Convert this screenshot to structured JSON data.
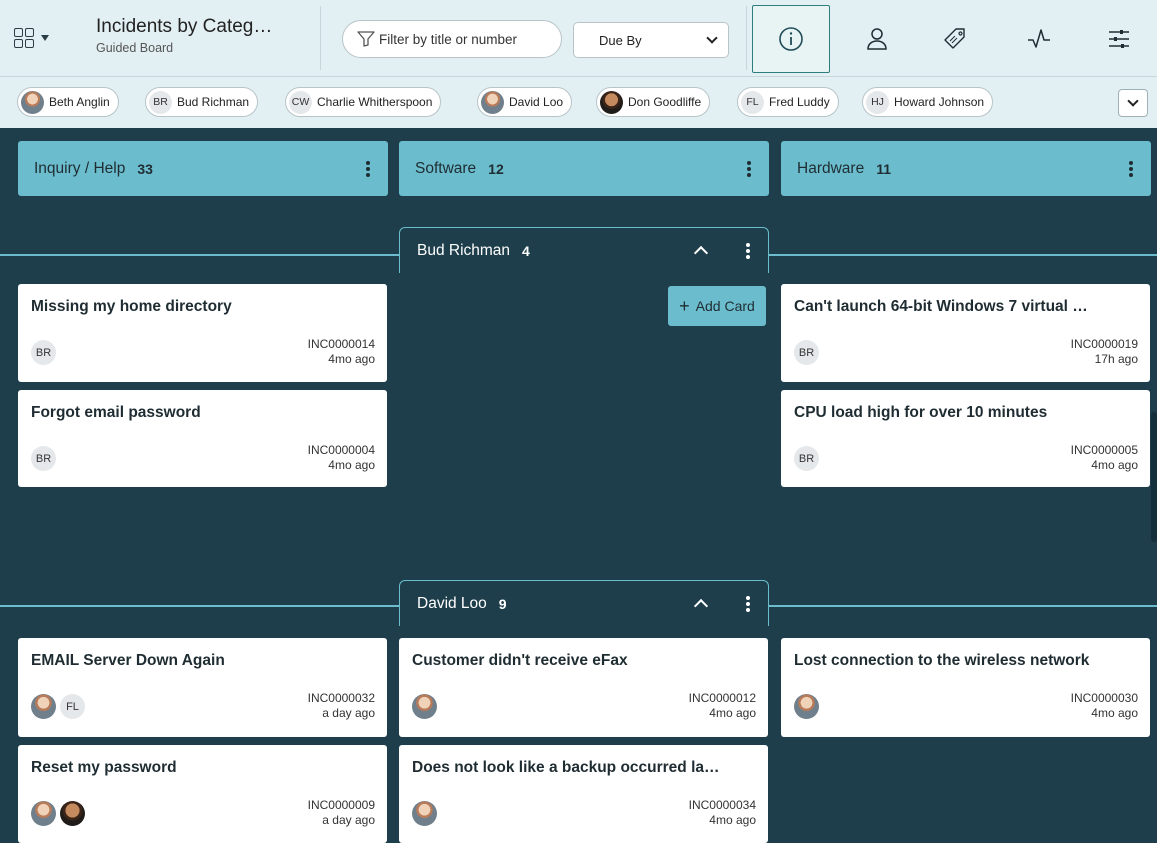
{
  "header": {
    "title": "Incidents by Categ…",
    "subtitle": "Guided Board",
    "filter_placeholder": "Filter by title or number",
    "sort_value": "Due By",
    "tools": [
      "info-icon",
      "person-icon",
      "tag-icon",
      "activity-icon",
      "sliders-icon"
    ]
  },
  "people": [
    {
      "name": "Beth Anglin",
      "initials": "",
      "photo": true
    },
    {
      "name": "Bud Richman",
      "initials": "BR",
      "photo": false
    },
    {
      "name": "Charlie Whitherspoon",
      "initials": "CW",
      "photo": false
    },
    {
      "name": "David Loo",
      "initials": "",
      "photo": true
    },
    {
      "name": "Don Goodliffe",
      "initials": "",
      "photo": true
    },
    {
      "name": "Fred Luddy",
      "initials": "FL",
      "photo": false
    },
    {
      "name": "Howard Johnson",
      "initials": "HJ",
      "photo": false
    }
  ],
  "columns": [
    {
      "name": "Inquiry / Help",
      "count": "33"
    },
    {
      "name": "Software",
      "count": "12"
    },
    {
      "name": "Hardware",
      "count": "11"
    }
  ],
  "lanes": [
    {
      "name": "Bud Richman",
      "count": "4"
    },
    {
      "name": "David Loo",
      "count": "9"
    }
  ],
  "add_card_label": "Add Card",
  "cards": [
    {
      "title": "Missing my home directory",
      "number": "INC0000014",
      "age": "4mo ago",
      "avatars": [
        "BR"
      ]
    },
    {
      "title": "Forgot email password",
      "number": "INC0000004",
      "age": "4mo ago",
      "avatars": [
        "BR"
      ]
    },
    {
      "title": "Can't launch 64-bit Windows 7 virtual …",
      "number": "INC0000019",
      "age": "17h ago",
      "avatars": [
        "BR"
      ]
    },
    {
      "title": "CPU load high for over 10 minutes",
      "number": "INC0000005",
      "age": "4mo ago",
      "avatars": [
        "BR"
      ]
    },
    {
      "title": "EMAIL Server Down Again",
      "number": "INC0000032",
      "age": "a day ago",
      "avatars": [
        "David Loo",
        "FL"
      ]
    },
    {
      "title": "Reset my password",
      "number": "INC0000009",
      "age": "a day ago",
      "avatars": [
        "David Loo",
        "Don Goodliffe"
      ]
    },
    {
      "title": "Customer didn't receive eFax",
      "number": "INC0000012",
      "age": "4mo ago",
      "avatars": [
        "David Loo"
      ]
    },
    {
      "title": "Does not look like a backup occurred la…",
      "number": "INC0000034",
      "age": "4mo ago",
      "avatars": [
        "David Loo"
      ]
    },
    {
      "title": "Lost connection to the wireless network",
      "number": "INC0000030",
      "age": "4mo ago",
      "avatars": [
        "David Loo"
      ]
    }
  ]
}
